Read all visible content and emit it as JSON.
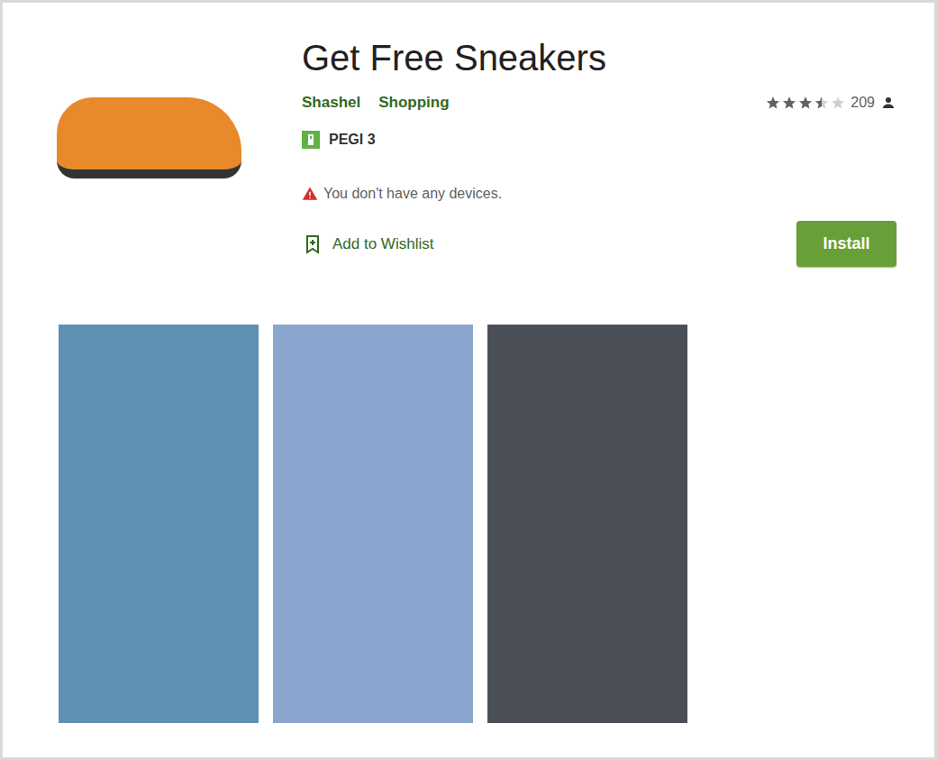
{
  "app": {
    "title": "Get Free Sneakers",
    "developer": "Shashel",
    "category": "Shopping",
    "rating": {
      "stars": 3.5,
      "count": "209"
    },
    "content_rating": "PEGI 3",
    "warning": "You don't have any devices.",
    "wishlist": "Add to Wishlist",
    "install": "Install"
  },
  "screenshots": [
    {
      "color": "#5f8fb3"
    },
    {
      "color": "#8aa6cf"
    },
    {
      "color": "#4b5058"
    }
  ]
}
